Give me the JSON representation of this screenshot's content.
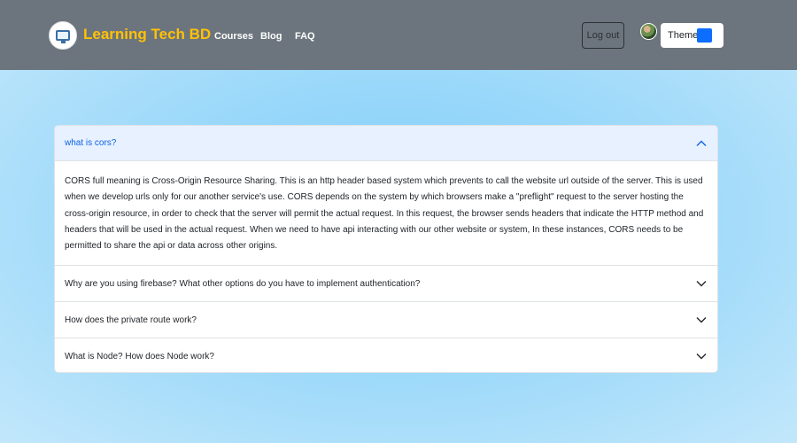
{
  "navbar": {
    "brand": "Learning Tech BD",
    "links": [
      "Courses",
      "Blog",
      "FAQ"
    ],
    "logout_label": "Log out",
    "theme_label": "Theme",
    "theme_swatch_color": "#0d6efd"
  },
  "faq": {
    "items": [
      {
        "question": "what is cors?",
        "expanded": true,
        "answer": "CORS full meaning is Cross-Origin Resource Sharing. This is an http header based system which prevents to call the website url outside of the server. This is used when we develop urls only for our another service's use. CORS depends on the system by which browsers make a \"preflight\" request to the server hosting the cross-origin resource, in order to check that the server will permit the actual request. In this request, the browser sends headers that indicate the HTTP method and headers that will be used in the actual request. When we need to have api interacting with our other website or system, In these instances, CORS needs to be permitted to share the api or data across other origins."
      },
      {
        "question": "Why are you using firebase? What other options do you have to implement authentication?",
        "expanded": false
      },
      {
        "question": "How does the private route work?",
        "expanded": false
      },
      {
        "question": "What is Node? How does Node work?",
        "expanded": false
      }
    ]
  },
  "icons": {
    "chevron_up": "chevron-up-icon",
    "chevron_down": "chevron-down-icon"
  }
}
